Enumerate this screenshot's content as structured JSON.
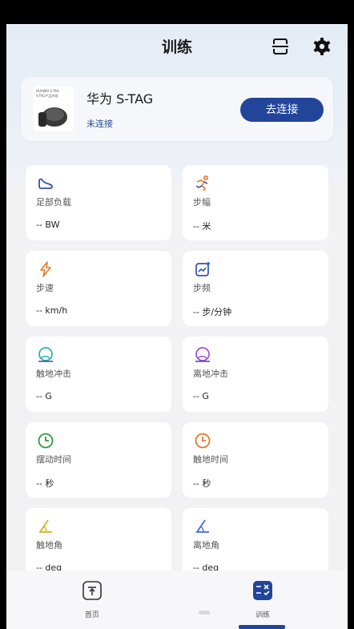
{
  "header": {
    "title": "训练",
    "scan_icon": "scan-frame-icon",
    "settings_icon": "gear-icon"
  },
  "device": {
    "thumb_brand": "HUAWEI S-TAG",
    "thumb_sub": "S-TAG产品外观",
    "name": "华为 S-TAG",
    "status": "未连接",
    "connect_label": "去连接"
  },
  "metrics": [
    {
      "id": "foot-load",
      "label": "足部负载",
      "value": "-- BW",
      "icon": "shoe-icon",
      "color": "#3353a8"
    },
    {
      "id": "stride",
      "label": "步幅",
      "value": "-- 米",
      "icon": "runner-icon",
      "color": "#e8762c"
    },
    {
      "id": "pace",
      "label": "步速",
      "value": "-- km/h",
      "icon": "lightning-icon",
      "color": "#e8762c"
    },
    {
      "id": "cadence",
      "label": "步频",
      "value": "-- 步/分钟",
      "icon": "trend-chart-icon",
      "color": "#3353a8"
    },
    {
      "id": "landing-impact",
      "label": "触地冲击",
      "value": "-- G",
      "icon": "impact-swirl-icon",
      "color": "#2bb3a8"
    },
    {
      "id": "takeoff-impact",
      "label": "离地冲击",
      "value": "-- G",
      "icon": "impact-swirl-icon",
      "color": "#a64bd1"
    },
    {
      "id": "swing-time",
      "label": "摆动时间",
      "value": "-- 秒",
      "icon": "clock-icon",
      "color": "#2e9a40"
    },
    {
      "id": "contact-time",
      "label": "触地时间",
      "value": "-- 秒",
      "icon": "clock-icon",
      "color": "#e8762c"
    },
    {
      "id": "landing-angle",
      "label": "触地角",
      "value": "-- deg",
      "icon": "angle-icon",
      "color": "#d6b21c"
    },
    {
      "id": "takeoff-angle",
      "label": "离地角",
      "value": "-- deg",
      "icon": "angle-icon",
      "color": "#3a6fd8"
    }
  ],
  "nav": {
    "home_label": "首页",
    "train_label": "训练",
    "home_icon": "upload-tray-icon",
    "train_icon": "checklist-icon",
    "accent": "#22459a"
  }
}
